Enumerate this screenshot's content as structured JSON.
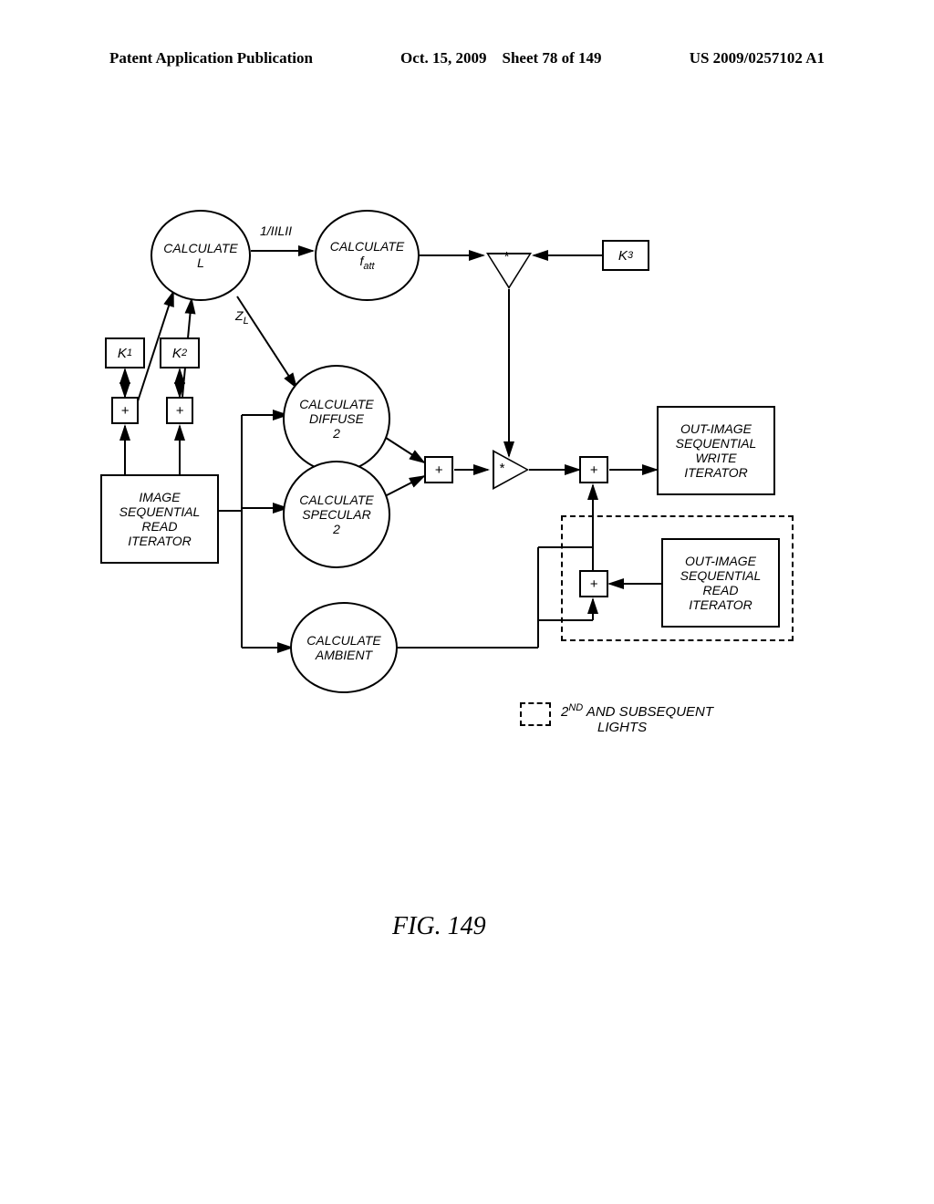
{
  "header": {
    "pub_label": "Patent Application Publication",
    "date": "Oct. 15, 2009",
    "sheet": "Sheet 78 of 149",
    "pub_id": "US 2009/0257102 A1"
  },
  "nodes": {
    "calc_L": "CALCULATE\nL",
    "calc_fatt_line1": "CALCULATE",
    "calc_fatt_sym": "f",
    "calc_fatt_sub": "att",
    "calc_diffuse": "CALCULATE\nDIFFUSE\n2",
    "calc_specular": "CALCULATE\nSPECULAR\n2",
    "calc_ambient": "CALCULATE\nAMBIENT",
    "K1": "K",
    "K1_sub": "1",
    "K2": "K",
    "K2_sub": "2",
    "K3": "K",
    "K3_sub": "3",
    "plus": "+",
    "mul": "*",
    "read_iter": "IMAGE\nSEQUENTIAL\nREAD\nITERATOR",
    "write_iter": "OUT-IMAGE\nSEQUENTIAL\nWRITE\nITERATOR",
    "out_read_iter": "OUT-IMAGE\nSEQUENTIAL\nREAD\nITERATOR"
  },
  "edge_labels": {
    "one_over_L": "1/IILII",
    "ZL": "Z",
    "ZL_sub": "L"
  },
  "legend": {
    "line1_pre": "2",
    "line1_sup": "ND",
    "line1_post": " AND SUBSEQUENT",
    "line2": "LIGHTS"
  },
  "figure_label": "FIG. 149"
}
